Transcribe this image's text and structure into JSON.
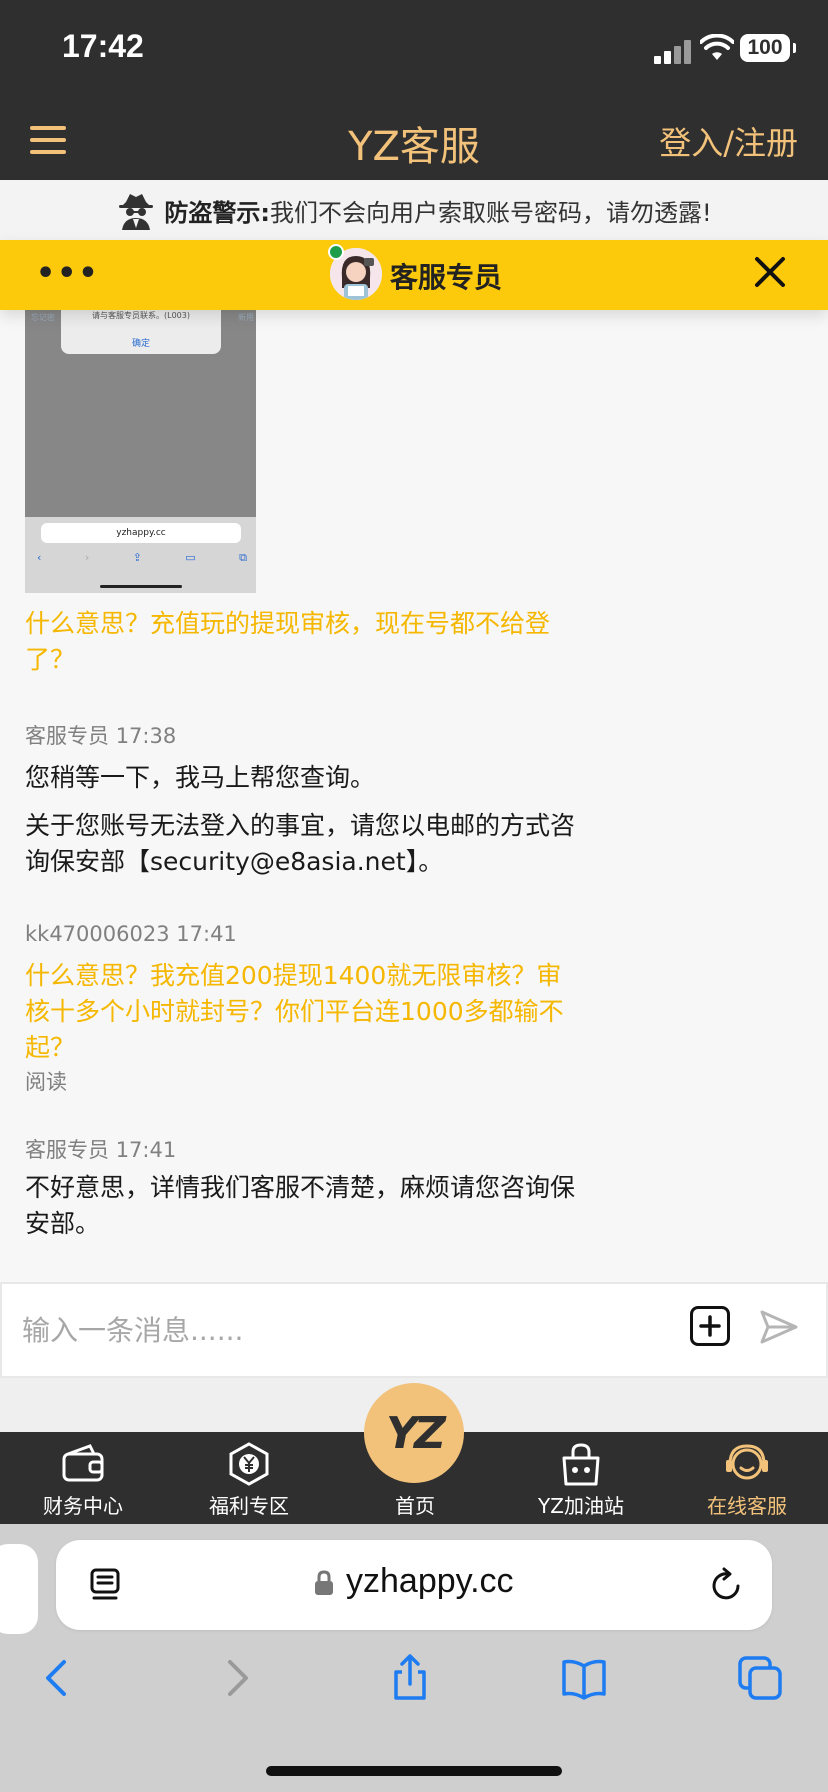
{
  "status_bar": {
    "time": "17:42",
    "battery": "100"
  },
  "header": {
    "title": "YZ客服",
    "login": "登入/注册"
  },
  "warning": {
    "label": "防盗警示:",
    "text": "我们不会向用户索取账号密码，请勿透露!"
  },
  "chat_header": {
    "agent": "客服专员"
  },
  "screenshot": {
    "dialog_text": "请与客服专员联系。(L003)",
    "confirm": "确定",
    "url": "yzhappy.cc",
    "side_left": "忘记密",
    "side_right": "新用"
  },
  "messages": [
    {
      "sender": "",
      "time": "",
      "text": "什么意思？充值玩的提现审核，现在号都不给登了？"
    },
    {
      "sender": "客服专员",
      "time": "17:38",
      "text": "您稍等一下，我马上帮您查询。"
    },
    {
      "sender": "",
      "time": "",
      "text": "关于您账号无法登入的事宜，请您以电邮的方式咨询保安部【security@e8asia.net】。"
    },
    {
      "sender": "kk470006023",
      "time": "17:41",
      "text": "什么意思？我充值200提现1400就无限审核？审核十多个小时就封号？你们平台连1000多都输不起？",
      "status": "阅读"
    },
    {
      "sender": "客服专员",
      "time": "17:41",
      "text": "不好意思，详情我们客服不清楚，麻烦请您咨询保安部。"
    }
  ],
  "input": {
    "placeholder": "输入一条消息......"
  },
  "bottom_nav": {
    "items": [
      {
        "label": "财务中心",
        "icon": "wallet-icon"
      },
      {
        "label": "福利专区",
        "icon": "yen-hexagon-icon"
      },
      {
        "label": "首页",
        "icon": "yz-logo-icon"
      },
      {
        "label": "YZ加油站",
        "icon": "shopping-bag-icon"
      },
      {
        "label": "在线客服",
        "icon": "headset-icon"
      }
    ],
    "home_logo": "YZ",
    "accent": "#f2c27a"
  },
  "safari": {
    "url": "yzhappy.cc"
  },
  "colors": {
    "brand": "#f2c27a",
    "chat_bar": "#fdc90b",
    "user_text": "#f5b700",
    "dark": "#2f2f2f"
  }
}
